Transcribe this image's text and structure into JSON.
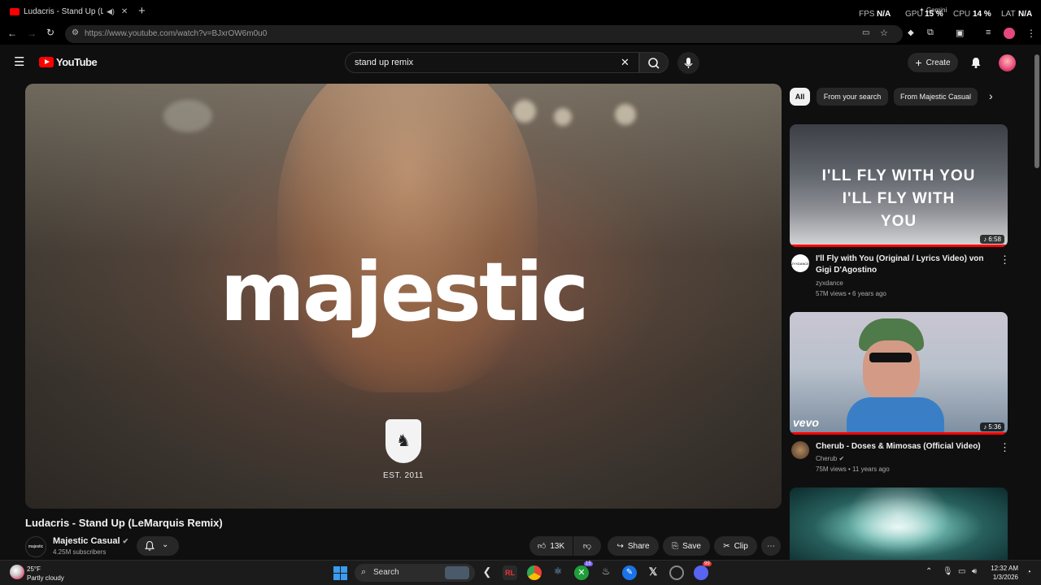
{
  "browser": {
    "tab_title": "Ludacris - Stand Up (LeMar",
    "url": "https://www.youtube.com/watch?v=BJxrOW6m0u0",
    "gemini_label": "Gemini",
    "stats": {
      "fps_label": "FPS",
      "fps_value": "N/A",
      "gpu_label": "GPU",
      "gpu_value": "15 %",
      "cpu_label": "CPU",
      "cpu_value": "14 %",
      "lat_label": "LAT",
      "lat_value": "N/A"
    }
  },
  "youtube": {
    "logo_text": "YouTube",
    "search_query": "stand up remix",
    "create_label": "Create"
  },
  "player": {
    "overlay_word": "majestic",
    "est_text": "EST. 2011"
  },
  "video": {
    "title": "Ludacris - Stand Up (LeMarquis Remix)",
    "channel": "Majestic Casual",
    "channel_avatar_text": "majestic",
    "subscribers": "4.25M subscribers",
    "likes": "13K",
    "share_label": "Share",
    "save_label": "Save",
    "clip_label": "Clip"
  },
  "chips": [
    "All",
    "From your search",
    "From Majestic Casual"
  ],
  "recommendations": [
    {
      "thumb_text": [
        "I'LL FLY WITH YOU",
        "I'LL FLY WITH",
        "YOU"
      ],
      "duration": "6:58",
      "title": "I'll Fly with You (Original / Lyrics Video) von Gigi D'Agostino",
      "channel": "zyxdance",
      "meta": "57M views • 6 years ago",
      "avatar_text": "ZYXDANCE",
      "progress": 1.0
    },
    {
      "thumb_text": [
        "vevo"
      ],
      "duration": "5:36",
      "title": "Cherub - Doses & Mimosas (Official Video)",
      "channel": "Cherub",
      "meta": "75M views • 11 years ago",
      "progress": 1.0
    }
  ],
  "taskbar": {
    "weather_temp": "25°F",
    "weather_desc": "Partly cloudy",
    "search_label": "Search",
    "time": "12:32 AM",
    "date": "1/3/2026",
    "badge_xbox": "15",
    "badge_discord": "99"
  },
  "colors": {
    "accent": "#ff0000",
    "background": "#0f0f0f",
    "chip": "#272727"
  }
}
